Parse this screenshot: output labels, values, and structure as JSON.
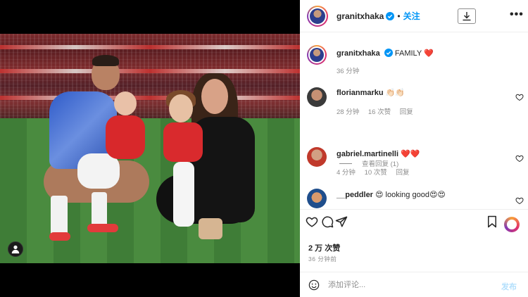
{
  "header": {
    "username": "granitxhaka",
    "separator": "•",
    "follow_label": "关注",
    "more_icon": "•••"
  },
  "caption": {
    "username": "granitxhaka",
    "text": "FAMILY ❤️",
    "time": "36 分钟"
  },
  "comments": [
    {
      "username": "florianmarku",
      "text": "👏🏻👏🏻",
      "time": "28 分钟",
      "likes": "16 次赞",
      "reply": "回复"
    },
    {
      "username": "gabriel.martinelli",
      "text": "❤️❤️",
      "time": "4 分钟",
      "likes": "10 次赞",
      "reply": "回复"
    },
    {
      "username": "__peddler",
      "text": "😍 looking good😍😍"
    }
  ],
  "view_replies": "查看回复 (1)",
  "post": {
    "likes": "2 万 次赞",
    "time": "36 分钟前"
  },
  "add_comment": {
    "placeholder": "添加评论...",
    "post_label": "发布"
  },
  "colors": {
    "accent": "#0095f6",
    "heart": "#ed4956",
    "post_disabled": "#b2dffc"
  }
}
